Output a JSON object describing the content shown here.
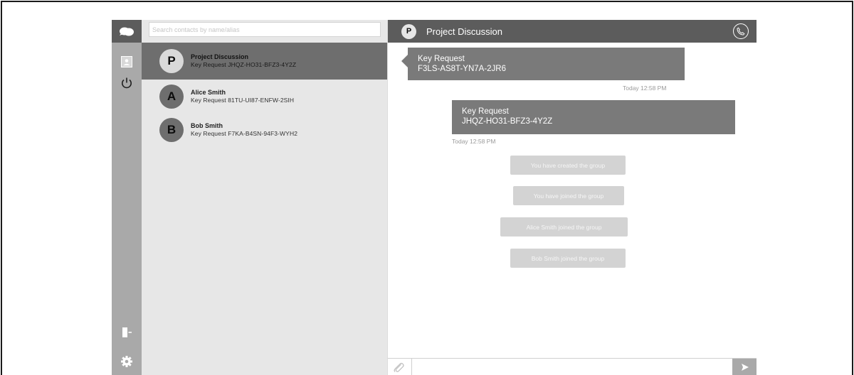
{
  "search": {
    "placeholder": "Search contacts by name/alias"
  },
  "contacts": [
    {
      "initial": "P",
      "name": "Project Discussion",
      "subtitle": "Key Request JHQZ-HO31-BFZ3-4Y2Z",
      "active": true
    },
    {
      "initial": "A",
      "name": "Alice Smith",
      "subtitle": "Key Request 81TU-UI87-ENFW-2SIH",
      "active": false
    },
    {
      "initial": "B",
      "name": "Bob Smith",
      "subtitle": "Key Request F7KA-B4SN-94F3-WYH2",
      "active": false
    }
  ],
  "chat": {
    "header": {
      "initial": "P",
      "title": "Project Discussion"
    },
    "messages": [
      {
        "direction": "incoming",
        "line1": "Key Request",
        "line2": "F3LS-AS8T-YN7A-2JR6",
        "time": "Today 12:58 PM"
      },
      {
        "direction": "outgoing",
        "line1": "Key Request",
        "line2": "JHQZ-HO31-BFZ3-4Y2Z",
        "time": "Today 12:58 PM"
      }
    ],
    "system_messages": [
      "You have created the group",
      "You have joined the group",
      "Alice Smith joined the group",
      "Bob Smith joined the group"
    ],
    "compose": {
      "value": ""
    }
  },
  "icons": {
    "app_logo": "chat-bubbles-icon",
    "contacts": "contact-card-icon",
    "power": "power-icon",
    "logout": "logout-icon",
    "settings": "gear-icon",
    "call": "phone-icon",
    "attach": "paperclip-icon",
    "send": "send-arrow-icon"
  },
  "colors": {
    "header_bar": "#5c5c5c",
    "rail": "#a9a9a9",
    "contacts_panel": "#e7e7e7",
    "active_contact": "#6e6e6e",
    "bubble": "#7a7a7a",
    "system_pill": "#d3d3d3"
  }
}
